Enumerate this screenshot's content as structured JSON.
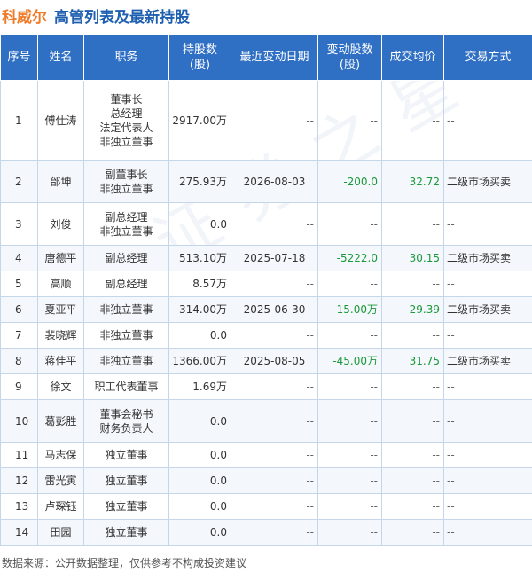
{
  "header": {
    "company": "科威尔",
    "title": "高管列表及最新持股"
  },
  "table": {
    "columns": [
      "序号",
      "姓名",
      "职务",
      "持股数\n(股)",
      "最近变动日期",
      "变动股数\n(股)",
      "成交均价",
      "交易方式"
    ],
    "rows": [
      {
        "no": "1",
        "name": "傅仕涛",
        "role": [
          "董事长",
          "总经理",
          "法定代表人",
          "非独立董事"
        ],
        "shares": "2917.00万",
        "date": "--",
        "change": "--",
        "price": "--",
        "method": "--"
      },
      {
        "no": "2",
        "name": "邰坤",
        "role": [
          "副董事长",
          "非独立董事"
        ],
        "shares": "275.93万",
        "date": "2026-08-03",
        "change": "-200.0",
        "price": "32.72",
        "method": "二级市场买卖"
      },
      {
        "no": "3",
        "name": "刘俊",
        "role": [
          "副总经理",
          "非独立董事"
        ],
        "shares": "0.0",
        "date": "--",
        "change": "--",
        "price": "--",
        "method": "--"
      },
      {
        "no": "4",
        "name": "唐德平",
        "role": [
          "副总经理"
        ],
        "shares": "513.10万",
        "date": "2025-07-18",
        "change": "-5222.0",
        "price": "30.15",
        "method": "二级市场买卖"
      },
      {
        "no": "5",
        "name": "高顺",
        "role": [
          "副总经理"
        ],
        "shares": "8.57万",
        "date": "--",
        "change": "--",
        "price": "--",
        "method": "--"
      },
      {
        "no": "6",
        "name": "夏亚平",
        "role": [
          "非独立董事"
        ],
        "shares": "314.00万",
        "date": "2025-06-30",
        "change": "-15.00万",
        "price": "29.39",
        "method": "二级市场买卖"
      },
      {
        "no": "7",
        "name": "裴晓辉",
        "role": [
          "非独立董事"
        ],
        "shares": "0.0",
        "date": "--",
        "change": "--",
        "price": "--",
        "method": "--"
      },
      {
        "no": "8",
        "name": "蒋佳平",
        "role": [
          "非独立董事"
        ],
        "shares": "1366.00万",
        "date": "2025-08-05",
        "change": "-45.00万",
        "price": "31.75",
        "method": "二级市场买卖"
      },
      {
        "no": "9",
        "name": "徐文",
        "role": [
          "职工代表董事"
        ],
        "shares": "1.69万",
        "date": "--",
        "change": "--",
        "price": "--",
        "method": "--"
      },
      {
        "no": "10",
        "name": "葛彭胜",
        "role": [
          "董事会秘书",
          "财务负责人"
        ],
        "shares": "0.0",
        "date": "--",
        "change": "--",
        "price": "--",
        "method": "--"
      },
      {
        "no": "11",
        "name": "马志保",
        "role": [
          "独立董事"
        ],
        "shares": "0.0",
        "date": "--",
        "change": "--",
        "price": "--",
        "method": "--"
      },
      {
        "no": "12",
        "name": "雷光寅",
        "role": [
          "独立董事"
        ],
        "shares": "0.0",
        "date": "--",
        "change": "--",
        "price": "--",
        "method": "--"
      },
      {
        "no": "13",
        "name": "卢琛钰",
        "role": [
          "独立董事"
        ],
        "shares": "0.0",
        "date": "--",
        "change": "--",
        "price": "--",
        "method": "--"
      },
      {
        "no": "14",
        "name": "田园",
        "role": [
          "独立董事"
        ],
        "shares": "0.0",
        "date": "--",
        "change": "--",
        "price": "--",
        "method": "--"
      }
    ]
  },
  "footer": {
    "source": "数据来源：公开数据整理，仅供参考不构成投资建议"
  },
  "colors": {
    "header_bg": "#2f6fc4",
    "company": "#f07b2a",
    "title": "#1f5fb0",
    "positive_green": "#1a9a3a"
  }
}
